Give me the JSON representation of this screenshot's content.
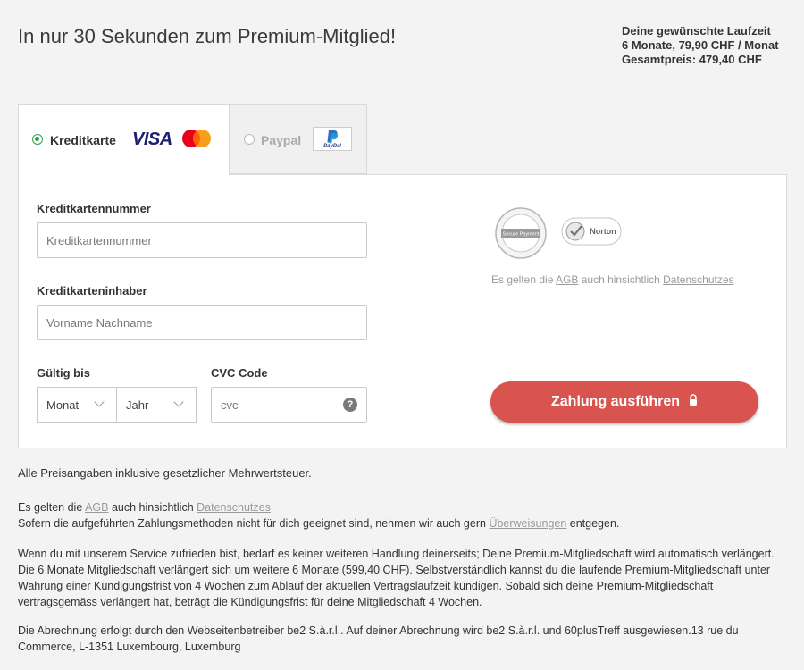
{
  "header": {
    "title": "In nur 30 Sekunden zum Premium-Mitglied!",
    "summary_label": "Deine gewünschte Laufzeit",
    "summary_plan": "6 Monate, 79,90 CHF / Monat",
    "summary_total": "Gesamtpreis: 479,40 CHF"
  },
  "tabs": {
    "card_label": "Kreditkarte",
    "visa_logo": "VISA",
    "paypal_label": "Paypal",
    "paypal_logo": "PayPal"
  },
  "form": {
    "card_number_label": "Kreditkartennummer",
    "card_number_placeholder": "Kreditkartennummer",
    "card_holder_label": "Kreditkarteninhaber",
    "card_holder_placeholder": "Vorname Nachname",
    "valid_label": "Gültig bis",
    "month_value": "Monat",
    "year_value": "Jahr",
    "cvc_label": "CVC Code",
    "cvc_placeholder": "cvc",
    "cvc_help": "?"
  },
  "trust": {
    "seal1": "Secure Payment",
    "seal2": "Norton",
    "agb_prefix": "Es gelten die ",
    "agb_link": "AGB",
    "agb_middle": " auch hinsichtlich ",
    "privacy_link": "Datenschutzes"
  },
  "pay_button": "Zahlung ausführen",
  "footer": {
    "vat": "Alle Preisangaben inklusive gesetzlicher Mehrwertsteuer.",
    "agb_prefix": "Es gelten die ",
    "agb_link": "AGB",
    "agb_middle": " auch hinsichtlich ",
    "privacy_link": "Datenschutzes",
    "methods_prefix": "Sofern die aufgeführten Zahlungsmethoden nicht für dich geeignet sind, nehmen wir auch gern ",
    "methods_link": "Überweisungen",
    "methods_suffix": " entgegen.",
    "renewal": "Wenn du mit unserem Service zufrieden bist, bedarf es keiner weiteren Handlung deinerseits; Deine Premium-Mitgliedschaft wird automatisch verlängert. Die 6 Monate Mitgliedschaft verlängert sich um weitere 6 Monate (599,40 CHF). Selbstverständlich kannst du die laufende Premium-Mitgliedschaft unter Wahrung einer Kündigungsfrist von 4 Wochen zum Ablauf der aktuellen Vertragslaufzeit kündigen. Sobald sich deine Premium-Mitgliedschaft vertragsgemäss verlängert hat, beträgt die Kündigungsfrist für deine Mitgliedschaft 4 Wochen.",
    "billing": "Die Abrechnung erfolgt durch den Webseitenbetreiber be2 S.à.r.l.. Auf deiner Abrechnung wird be2 S.à.r.l. und 60plusTreff ausgewiesen.13 rue du Commerce, L-1351 Luxembourg, Luxemburg"
  },
  "colors": {
    "accent_green": "#2aa14a",
    "pay_button": "#d9534f",
    "visa_blue": "#1a1f71"
  }
}
